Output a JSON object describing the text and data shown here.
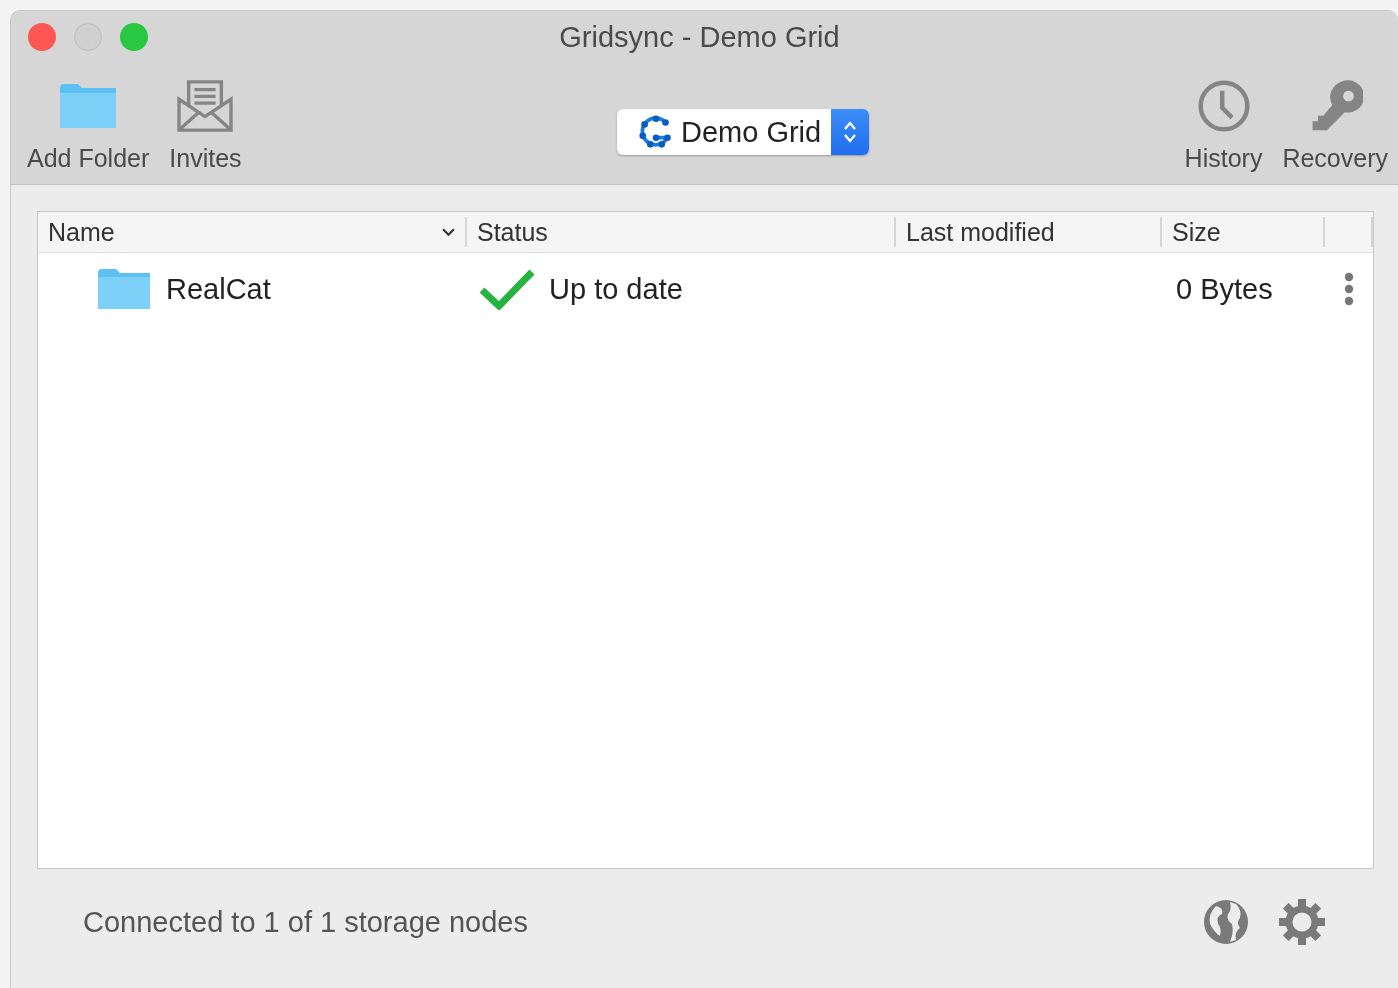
{
  "window": {
    "title": "Gridsync - Demo Grid"
  },
  "toolbar": {
    "left": [
      {
        "kind": "folder",
        "label": "Add Folder"
      },
      {
        "kind": "envelope",
        "label": "Invites"
      }
    ],
    "grid_selector": {
      "value": "Demo Grid"
    },
    "right": [
      {
        "kind": "clock",
        "label": "History"
      },
      {
        "kind": "key",
        "label": "Recovery"
      }
    ]
  },
  "table": {
    "columns": [
      {
        "label": "Name",
        "sorted": true
      },
      {
        "label": "Status",
        "sorted": false
      },
      {
        "label": "Last modified",
        "sorted": false
      },
      {
        "label": "Size",
        "sorted": false
      }
    ],
    "rows": [
      {
        "name": "RealCat",
        "status": "Up to date",
        "kind": "synced",
        "size": "0 Bytes"
      }
    ]
  },
  "status_bar": {
    "text": "Connected to 1 of 1 storage nodes"
  }
}
